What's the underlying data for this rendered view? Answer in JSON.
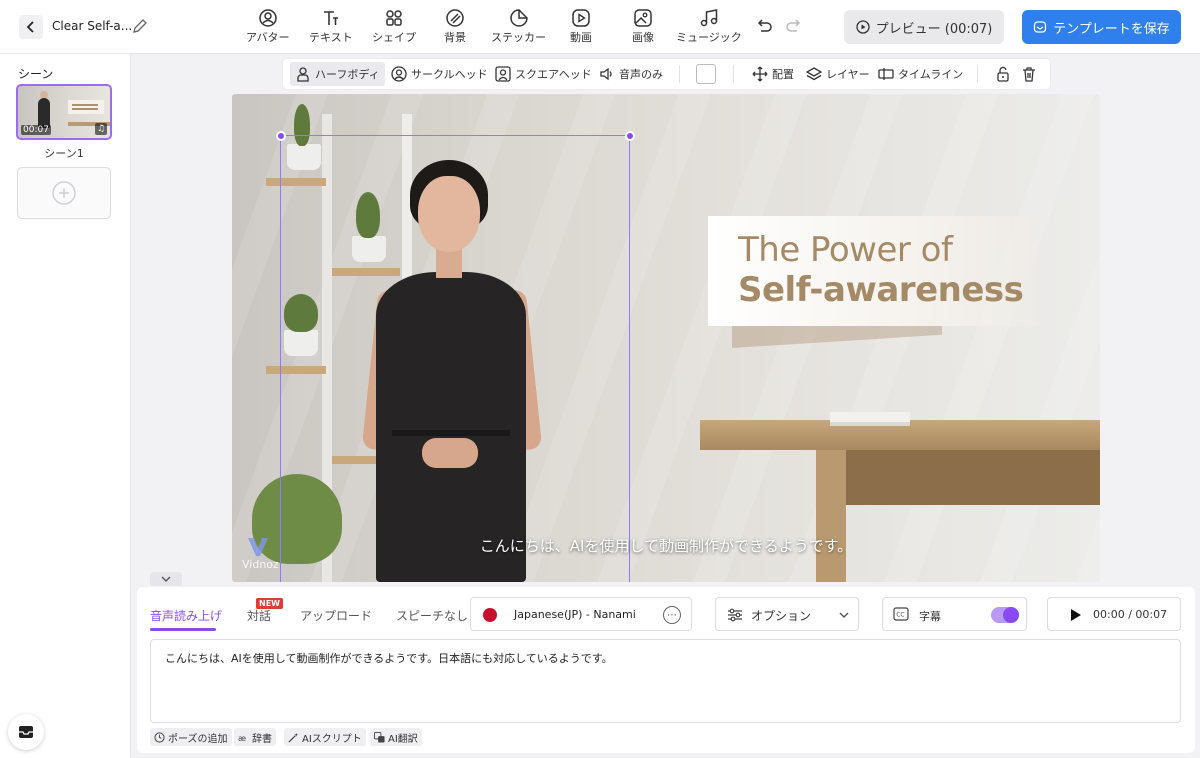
{
  "header": {
    "project_title": "Clear Self-a...",
    "tools": [
      {
        "label": "アバター",
        "icon": "avatar-icon"
      },
      {
        "label": "テキスト",
        "icon": "text-icon"
      },
      {
        "label": "シェイプ",
        "icon": "shape-icon"
      },
      {
        "label": "背景",
        "icon": "background-icon"
      },
      {
        "label": "ステッカー",
        "icon": "sticker-icon"
      },
      {
        "label": "動画",
        "icon": "video-icon"
      },
      {
        "label": "画像",
        "icon": "image-icon"
      },
      {
        "label": "ミュージック",
        "icon": "music-icon"
      }
    ],
    "preview_label": "プレビュー (00:07)",
    "save_label": "テンプレートを保存"
  },
  "sidebar": {
    "heading": "シーン",
    "scenes": [
      {
        "label": "シーン1",
        "duration": "00:07"
      }
    ]
  },
  "canvas_toolbar": {
    "half_body": "ハーフボディ",
    "circle_head": "サークルヘッド",
    "square_head": "スクエアヘッド",
    "voice_only": "音声のみ",
    "arrange": "配置",
    "layer": "レイヤー",
    "timeline": "タイムライン"
  },
  "stage": {
    "title_line1": "The Power of",
    "title_line2": "Self-awareness",
    "subtitle": "こんにちは、AIを使用して動画制作ができるようです。",
    "watermark": "Vidnoz"
  },
  "panel": {
    "tabs": [
      "音声読み上げ",
      "対話",
      "アップロード",
      "スピーチなし"
    ],
    "new_badge": "NEW",
    "voice": "Japanese(JP) - Nanami",
    "options_label": "オプション",
    "captions_label": "字幕",
    "playback": "00:00 / 00:07",
    "script": "こんにちは、AIを使用して動画制作ができるようです。日本語にも対応しているようです。",
    "chips": [
      "ポーズの追加",
      "辞書",
      "AIスクリプト",
      "AI翻訳"
    ]
  },
  "colors": {
    "accent": "#8a4af3",
    "primary_button": "#2f80ed",
    "title_text": "#a48a66"
  }
}
